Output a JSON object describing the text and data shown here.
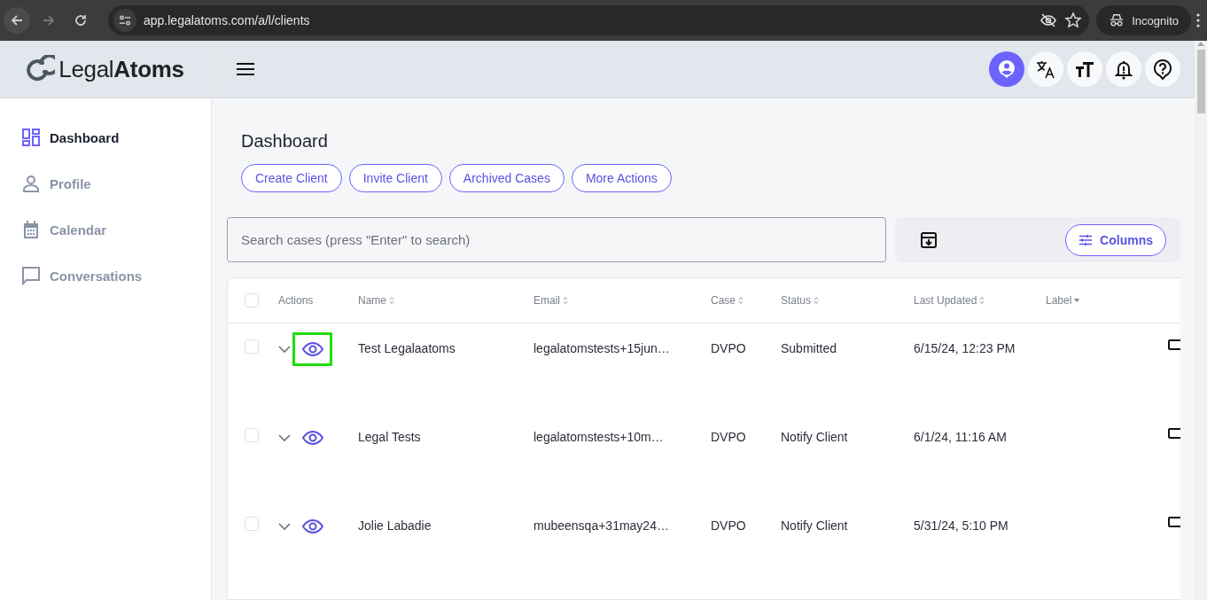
{
  "browser": {
    "url": "app.legalatoms.com/a/l/clients",
    "profile_label": "Incognito"
  },
  "logo": {
    "text": "Legal**Atoms**"
  },
  "header_buttons": [
    {
      "kind": "profile",
      "selected": true
    },
    {
      "kind": "translate",
      "selected": false
    },
    {
      "kind": "text-size",
      "selected": false
    },
    {
      "kind": "bell",
      "selected": false
    },
    {
      "kind": "help",
      "selected": false
    }
  ],
  "sidebar": {
    "items": [
      {
        "label": "Dashboard",
        "kind": "dashboard",
        "selected": true
      },
      {
        "label": "Profile",
        "kind": "profile",
        "selected": false
      },
      {
        "label": "Calendar",
        "kind": "calendar",
        "selected": false
      },
      {
        "label": "Conversations",
        "kind": "conversations",
        "selected": false
      }
    ]
  },
  "page": {
    "title": "Dashboard",
    "actions": [
      "Create Client",
      "Invite Client",
      "Archived Cases",
      "More Actions"
    ]
  },
  "search": {
    "placeholder": "Search cases (press \"Enter\" to search)"
  },
  "columns_button": "Columns",
  "table": {
    "all_checked": false,
    "columns": [
      {
        "label": "Actions",
        "kind": "plain"
      },
      {
        "label": "Name",
        "kind": "sortable"
      },
      {
        "label": "Email",
        "kind": "sortable"
      },
      {
        "label": "Case",
        "kind": "sortable"
      },
      {
        "label": "Status",
        "kind": "sortable"
      },
      {
        "label": "Last Updated",
        "kind": "sortable"
      },
      {
        "label": "Label",
        "kind": "dropdown"
      }
    ],
    "rows": [
      {
        "checked": false,
        "highlighted": true,
        "name": "Test Legalaatoms",
        "email": "legalatomstests+15jun…",
        "case": "DVPO",
        "status": "Submitted",
        "last_updated": "6/15/24, 12:23 PM"
      },
      {
        "checked": false,
        "highlighted": false,
        "name": "Legal Tests",
        "email": "legalatomstests+10m…",
        "case": "DVPO",
        "status": "Notify Client",
        "last_updated": "6/1/24, 11:16 AM"
      },
      {
        "checked": false,
        "highlighted": false,
        "name": "Jolie Labadie",
        "email": "mubeensqa+31may24…",
        "case": "DVPO",
        "status": "Notify Client",
        "last_updated": "5/31/24, 5:10 PM"
      }
    ]
  }
}
